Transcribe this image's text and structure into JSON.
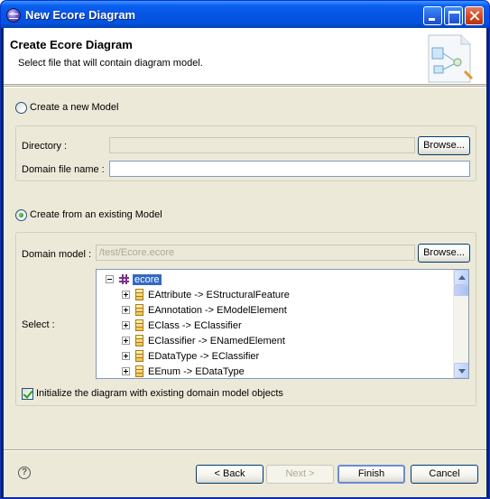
{
  "window": {
    "title": "New Ecore Diagram",
    "accent": "#0554e3"
  },
  "banner": {
    "title": "Create Ecore Diagram",
    "description": "Select file that will contain diagram model."
  },
  "new_model": {
    "radio_label": "Create a new Model",
    "selected": false,
    "directory_label": "Directory :",
    "directory_value": "",
    "browse_label": "Browse...",
    "domain_file_label": "Domain file name :",
    "domain_file_value": ""
  },
  "existing_model": {
    "radio_label": "Create from an existing Model",
    "selected": true,
    "domain_model_label": "Domain model :",
    "domain_model_value": "/test/Ecore.ecore",
    "browse_label": "Browse...",
    "select_label": "Select :",
    "tree": {
      "root": "ecore",
      "items": [
        "EAttribute -> EStructuralFeature",
        "EAnnotation -> EModelElement",
        "EClass -> EClassifier",
        "EClassifier -> ENamedElement",
        "EDataType -> EClassifier",
        "EEnum -> EDataType"
      ]
    },
    "init_checkbox_label": "Initialize the diagram with existing domain model objects",
    "init_checked": true
  },
  "footer": {
    "help_icon": "help-icon",
    "back_label": "< Back",
    "next_label": "Next >",
    "finish_label": "Finish",
    "cancel_label": "Cancel"
  }
}
